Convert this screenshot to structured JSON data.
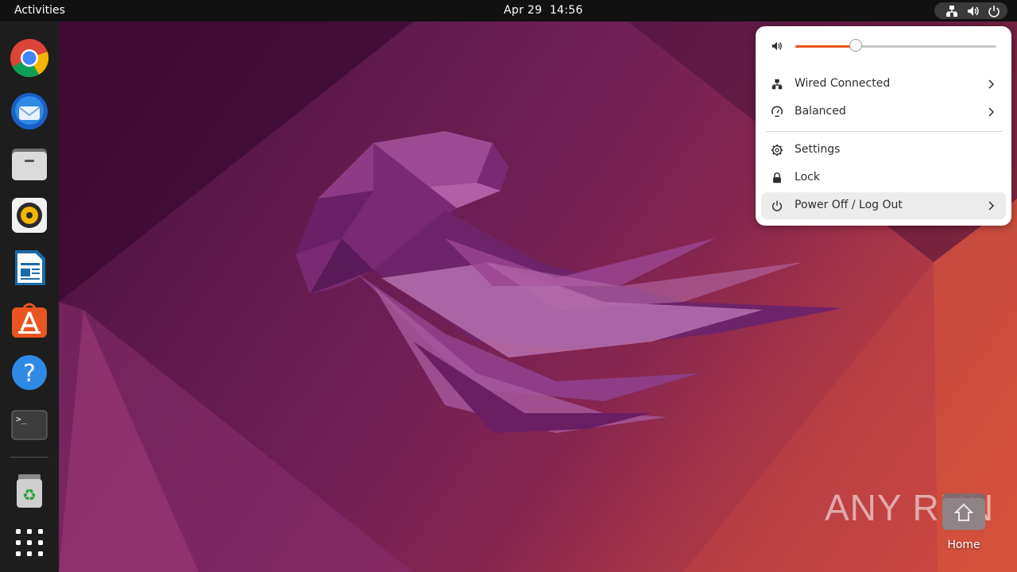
{
  "topbar": {
    "activities_label": "Activities",
    "date": "Apr 29",
    "time": "14:56",
    "tray_icons": [
      "network-wired-icon",
      "volume-icon",
      "power-icon"
    ]
  },
  "dock": {
    "apps": [
      {
        "name": "Google Chrome",
        "icon": "chrome-icon"
      },
      {
        "name": "Thunderbird",
        "icon": "thunderbird-icon"
      },
      {
        "name": "Files",
        "icon": "files-icon"
      },
      {
        "name": "Rhythmbox",
        "icon": "rhythmbox-icon"
      },
      {
        "name": "LibreOffice Writer",
        "icon": "writer-icon"
      },
      {
        "name": "Ubuntu Software",
        "icon": "software-icon"
      },
      {
        "name": "Help",
        "icon": "help-icon"
      },
      {
        "name": "Terminal",
        "icon": "terminal-icon"
      },
      {
        "name": "Trash",
        "icon": "trash-icon"
      },
      {
        "name": "Show Applications",
        "icon": "app-grid-icon"
      }
    ]
  },
  "menu": {
    "volume": {
      "icon": "speaker-icon",
      "level": 0.3
    },
    "items": [
      {
        "label": "Wired Connected",
        "icon": "network-wired-icon",
        "submenu": true
      },
      {
        "label": "Balanced",
        "icon": "power-profile-icon",
        "submenu": true
      },
      {
        "label": "Settings",
        "icon": "gear-icon",
        "submenu": false
      },
      {
        "label": "Lock",
        "icon": "lock-icon",
        "submenu": false
      },
      {
        "label": "Power Off / Log Out",
        "icon": "power-icon",
        "submenu": true,
        "highlighted": true
      }
    ]
  },
  "desktop": {
    "home_label": "Home",
    "watermark_text": "ANY RUN"
  },
  "colors": {
    "accent": "#e95420",
    "topbar": "#111111",
    "dock": "#1d1d1d",
    "menu_bg": "#ffffff"
  }
}
